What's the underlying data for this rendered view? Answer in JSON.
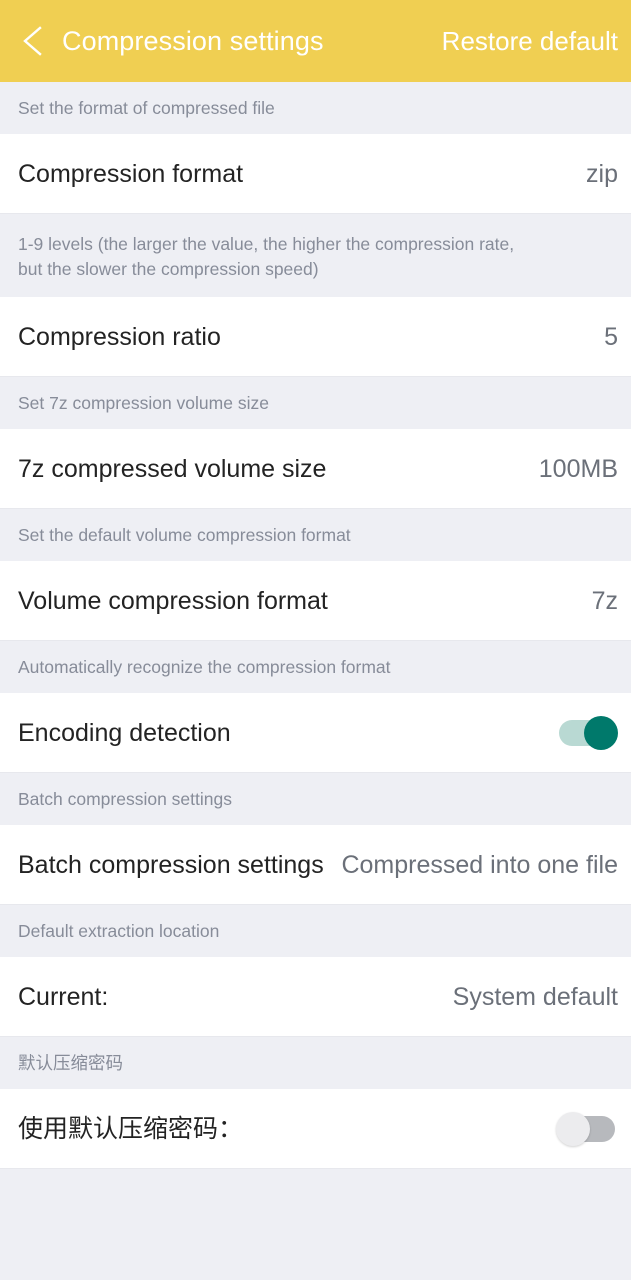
{
  "appbar": {
    "back_icon": "chevron-left-icon",
    "title": "Compression settings",
    "restore_label": "Restore default",
    "bg_color": "#f0cf52",
    "text_color": "#ffffff"
  },
  "sections": [
    {
      "header": "Set the format of compressed file",
      "row": {
        "label": "Compression format",
        "value": "zip",
        "type": "value"
      }
    },
    {
      "header_line1": "1-9 levels (the larger the value, the higher the compression rate,",
      "header_line2": "but the slower the compression speed)",
      "row": {
        "label": "Compression ratio",
        "value": "5",
        "type": "value"
      }
    },
    {
      "header": "Set 7z compression volume size",
      "row": {
        "label": "7z compressed volume size",
        "value": "100MB",
        "type": "value"
      }
    },
    {
      "header": "Set the default volume compression format",
      "row": {
        "label": "Volume compression format",
        "value": "7z",
        "type": "value"
      }
    },
    {
      "header": "Automatically recognize the compression format",
      "row": {
        "label": "Encoding detection",
        "type": "switch",
        "state": "on"
      }
    },
    {
      "header": "Batch compression settings",
      "row": {
        "label": "Batch compression settings",
        "value": "Compressed into one file",
        "type": "value-overlap"
      }
    },
    {
      "header": "Default extraction location",
      "row": {
        "label": "Current:",
        "value": "System default",
        "type": "value"
      }
    },
    {
      "header": "默认压缩密码",
      "row": {
        "label": "使用默认压缩密码：",
        "type": "switch",
        "state": "off"
      }
    }
  ],
  "colors": {
    "accent_yellow": "#f0cf52",
    "section_bg": "#eeeff4",
    "row_bg": "#ffffff",
    "label_text": "#232323",
    "value_text": "#6b7079",
    "header_text": "#878c99",
    "switch_on": "#00796b",
    "switch_on_track": "#b9d9d3",
    "switch_off_track": "#b7b9bd",
    "switch_off_thumb": "#ececee"
  }
}
